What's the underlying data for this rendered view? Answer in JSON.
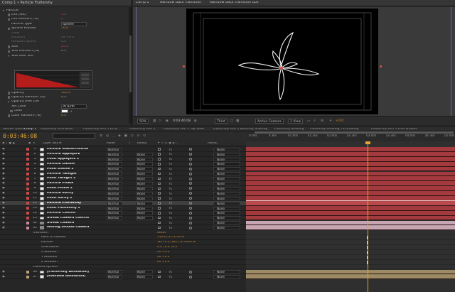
{
  "effect_controls": {
    "title": "Comp 1 • Particle Fluttershy",
    "rows": [
      {
        "label": "Particle",
        "value": "",
        "kind": "group-open",
        "indent": 0
      },
      {
        "label": "Life [sec]",
        "value": "3.0",
        "kind": "red",
        "indent": 2,
        "stopwatch": true
      },
      {
        "label": "Life Random [%]",
        "value": "0",
        "kind": "red",
        "indent": 2,
        "stopwatch": true
      },
      {
        "label": "Particle Type",
        "value": "Sphere",
        "kind": "dropdown",
        "indent": 2
      },
      {
        "label": "Sphere Feather",
        "value": "50.0",
        "kind": "orange",
        "indent": 2,
        "stopwatch": true
      },
      {
        "label": "Glow",
        "value": "",
        "kind": "dim",
        "indent": 2
      },
      {
        "label": "Rotation",
        "value": "0x +0.0°",
        "kind": "dim",
        "indent": 2
      },
      {
        "label": "Rotation Speed",
        "value": "0.0",
        "kind": "dim",
        "indent": 2
      },
      {
        "label": "Size",
        "value": "20.0",
        "kind": "red",
        "indent": 2,
        "stopwatch": true
      },
      {
        "label": "Size Random [%]",
        "value": "0.0",
        "kind": "orange",
        "indent": 2,
        "stopwatch": true
      },
      {
        "label": "Size over Life",
        "value": "",
        "kind": "group-open",
        "indent": 2
      }
    ],
    "rows_after_graph": [
      {
        "label": "Opacity",
        "value": "100.0",
        "kind": "orange",
        "indent": 2,
        "stopwatch": true
      },
      {
        "label": "Opacity Random [%]",
        "value": "0.0",
        "kind": "orange",
        "indent": 2,
        "stopwatch": true
      },
      {
        "label": "Opacity over Life",
        "value": "",
        "kind": "group",
        "indent": 2
      },
      {
        "label": "Set Color",
        "value": "At Birth",
        "kind": "dropdown",
        "indent": 2
      },
      {
        "label": "Color",
        "value": "",
        "kind": "swatch",
        "indent": 3,
        "stopwatch": true
      },
      {
        "label": "Color Random [%]",
        "value": "0.0",
        "kind": "orange",
        "indent": 2,
        "stopwatch": true
      }
    ]
  },
  "comp_viewer": {
    "tabs": [
      "Comp 1",
      "Rainbow Back Transition",
      "Rainbow Back Transition box"
    ],
    "zoom": "50%",
    "timecode": "0:03:46:08",
    "resolution": "Third",
    "camera": "Active Camera",
    "view": "1 View",
    "exposure": "+0.0"
  },
  "timeline": {
    "tabs": [
      "Render Queue",
      "Comp 1",
      "Fluttershy Animation",
      "Fluttershy Part 1 Echo",
      "Fluttershy Part 1",
      "Fluttershy Part 1 Top Mdle",
      "Fluttershy Part 1 Butterfly Shading",
      "Fluttershy Shading",
      "Fluttershy Shading, no shading",
      "Fluttershy Part 1 Line Strokes"
    ],
    "active_tab": "Comp 1",
    "timecode": "0:03:46:08",
    "ruler_ticks": [
      "0:00s",
      "0:30s",
      "01:00s",
      "01:30s",
      "02:00s",
      "02:30s",
      "03:00s",
      "03:30s",
      "04:00s",
      "04:30s",
      "05:00s"
    ],
    "columns": {
      "layer_name": "Layer Name",
      "mode": "Mode",
      "t": "T",
      "trkmat": "TrkMat",
      "parent": "Parent"
    },
    "layers": [
      {
        "num": "1",
        "name": "Particle MasterControl",
        "mode": "Normal",
        "trk": "",
        "parent": "None",
        "color": "#c94b4b",
        "icon": "solid"
      },
      {
        "num": "2",
        "name": "Particle Applejack",
        "mode": "Normal",
        "trk": "None",
        "parent": "None",
        "color": "#c94b4b",
        "icon": "solid"
      },
      {
        "num": "3",
        "name": "Point Applejack 2",
        "mode": "Normal",
        "trk": "None",
        "parent": "None",
        "color": "#c94b4b",
        "icon": "solid"
      },
      {
        "num": "4",
        "name": "Particle Dashie",
        "mode": "Normal",
        "trk": "None",
        "parent": "None",
        "color": "#c94b4b",
        "icon": "solid"
      },
      {
        "num": "5",
        "name": "Point Dashie 2",
        "mode": "Normal",
        "trk": "None",
        "parent": "None",
        "color": "#c94b4b",
        "icon": "solid"
      },
      {
        "num": "6",
        "name": "Particle Twilight",
        "mode": "Normal",
        "trk": "None",
        "parent": "None",
        "color": "#c94b4b",
        "icon": "solid"
      },
      {
        "num": "7",
        "name": "Point Twilight 2",
        "mode": "Normal",
        "trk": "None",
        "parent": "None",
        "color": "#c94b4b",
        "icon": "solid"
      },
      {
        "num": "8",
        "name": "Particle Pinkie",
        "mode": "Normal",
        "trk": "None",
        "parent": "None",
        "color": "#c94b4b",
        "icon": "solid"
      },
      {
        "num": "9",
        "name": "Point Pinkie 2",
        "mode": "Normal",
        "trk": "None",
        "parent": "None",
        "color": "#c94b4b",
        "icon": "solid"
      },
      {
        "num": "10",
        "name": "Particle Rarity",
        "mode": "Normal",
        "trk": "None",
        "parent": "None",
        "color": "#c94b4b",
        "icon": "solid"
      },
      {
        "num": "11",
        "name": "Point Rarity 2",
        "mode": "Normal",
        "trk": "None",
        "parent": "None",
        "color": "#c94b4b",
        "icon": "solid"
      },
      {
        "num": "12",
        "name": "Particle Fluttershy",
        "mode": "Normal",
        "trk": "None",
        "parent": "None",
        "color": "#c94b4b",
        "icon": "solid",
        "selected": true
      },
      {
        "num": "13",
        "name": "Point Fluttershy 2",
        "mode": "Normal",
        "trk": "None",
        "parent": "None",
        "color": "#c94b4b",
        "icon": "solid"
      },
      {
        "num": "14",
        "name": "Particle Control",
        "mode": "Normal",
        "trk": "None",
        "parent": "None",
        "color": "#c94b4b",
        "icon": "solid"
      },
      {
        "num": "15",
        "name": "Streak Camera Control",
        "mode": "Normal",
        "trk": "None",
        "parent": "None",
        "color": "#c94b4b",
        "icon": "solid"
      },
      {
        "num": "34",
        "name": "Streak Camera",
        "mode": "",
        "trk": "",
        "parent": "None",
        "color": "#c98ca2",
        "icon": "cam"
      },
      {
        "num": "35",
        "name": "Moving around camera",
        "mode": "",
        "trk": "",
        "parent": "None",
        "color": "#c98ca2",
        "icon": "cam"
      }
    ],
    "camera_props": [
      {
        "label": "Transform",
        "value": "Reset",
        "indent": 46
      },
      {
        "label": "Point of Interest",
        "value": "150.0,-51.3,-94.6",
        "indent": 58
      },
      {
        "label": "Position",
        "value": "-8271.5,-1817.4,-4421.8",
        "indent": 58
      },
      {
        "label": "Orientation",
        "value": "0.0°,0.0°,0.0°",
        "indent": 58
      },
      {
        "label": "X Rotation",
        "value": "0x +0.0°",
        "indent": 58
      },
      {
        "label": "Y Rotation",
        "value": "0x +0.0°",
        "indent": 58
      },
      {
        "label": "Z Rotation",
        "value": "0x +0.0°",
        "indent": 58
      },
      {
        "label": "Camera Options",
        "value": "",
        "indent": 46
      }
    ],
    "bottom_layers": [
      {
        "num": "36",
        "name": "[Fluttershy Animation]",
        "mode": "Normal",
        "trk": "None",
        "parent": "None",
        "color": "#b9a37a"
      },
      {
        "num": "37",
        "name": "[Rainbow Animation]",
        "mode": "Normal",
        "trk": "None",
        "parent": "None",
        "color": "#b9a37a"
      }
    ]
  }
}
